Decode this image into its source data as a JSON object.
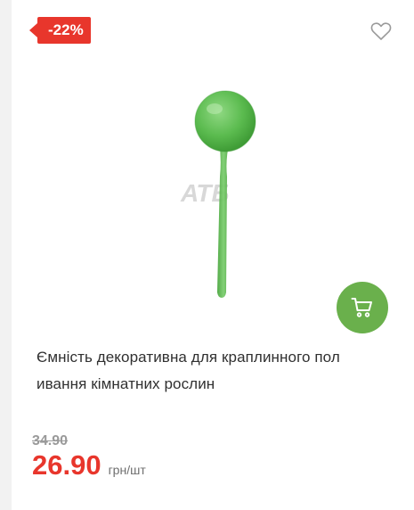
{
  "product": {
    "discount_badge": "-22%",
    "title": "Ємність декоративна для краплинного пол ивання кімнатних рослин",
    "watermark": "АТБ",
    "old_price": "34.90",
    "price": "26.90",
    "unit": "грн/шт"
  },
  "colors": {
    "badge_red": "#e8362c",
    "cart_green": "#6ab04c",
    "product_green": "#58b94d"
  },
  "icons": {
    "favorite": "heart-outline-icon",
    "cart": "shopping-cart-icon"
  }
}
